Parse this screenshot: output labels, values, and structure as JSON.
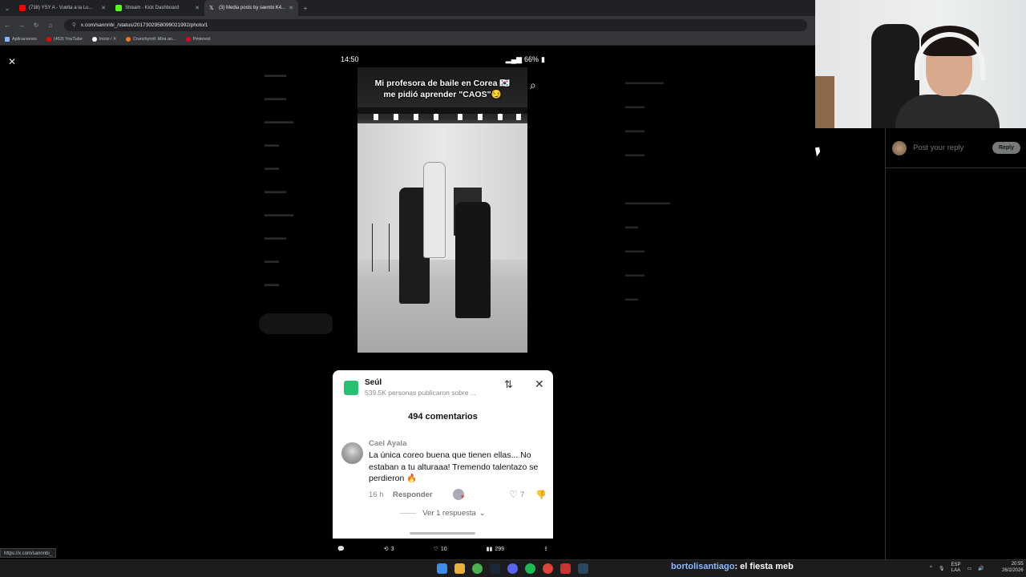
{
  "browser": {
    "tabs": [
      {
        "label": "(738) YSY A - Vuelta a la Lu...",
        "color": "#ff0000",
        "active": false
      },
      {
        "label": "Stream - Kick Dashboard",
        "color": "#53fc18",
        "active": false
      },
      {
        "label": "(3) Media posts by sæmbi K4...",
        "color": "#ffffff",
        "active": true
      }
    ],
    "url": "x.com/sannnbi_/status/2017302958099021992/photo/1",
    "bookmarks": [
      {
        "label": "Aplicaciones",
        "color": "#8ab4f8"
      },
      {
        "label": "(453) YouTube",
        "color": "#ff0000"
      },
      {
        "label": "Inicio / X",
        "color": "#ffffff"
      },
      {
        "label": "Crunchyroll: Mira an...",
        "color": "#f47521"
      },
      {
        "label": "Pinterest",
        "color": "#e60023"
      }
    ],
    "status_url": "https://x.com/sannnbi_"
  },
  "phone": {
    "time": "14:50",
    "battery": "66%",
    "caption_line1": "Mi profesora de baile en Corea 🇰🇷",
    "caption_line2": "me pidió aprender \"CAOS\"😏"
  },
  "comments": {
    "place": "Seúl",
    "place_sub": "539.5K personas publicaron sobre ...",
    "count_label": "494 comentarios",
    "comment": {
      "user": "Cael Ayala",
      "text": "La única coreo buena que tienen ellas... No estaban a tu alturaaa! Tremendo talentazo se perdieron 🔥",
      "time": "16 h",
      "reply_label": "Responder",
      "likes": "7"
    },
    "more_replies": "Ver 1 respuesta"
  },
  "post_actions": {
    "reposts": "3",
    "likes": "10",
    "views": "299"
  },
  "reply_panel": {
    "placeholder": "Post your reply",
    "button": "Reply"
  },
  "taskbar": {
    "chat_user": "bortolisantiago",
    "chat_message": ": el fiesta meb",
    "lang_top": "ESP",
    "lang_bottom": "LAA",
    "time": "20:55",
    "date": "26/2/2026"
  },
  "colors": {
    "accent_like": "#25c070",
    "reply_button": "#787a7a"
  }
}
